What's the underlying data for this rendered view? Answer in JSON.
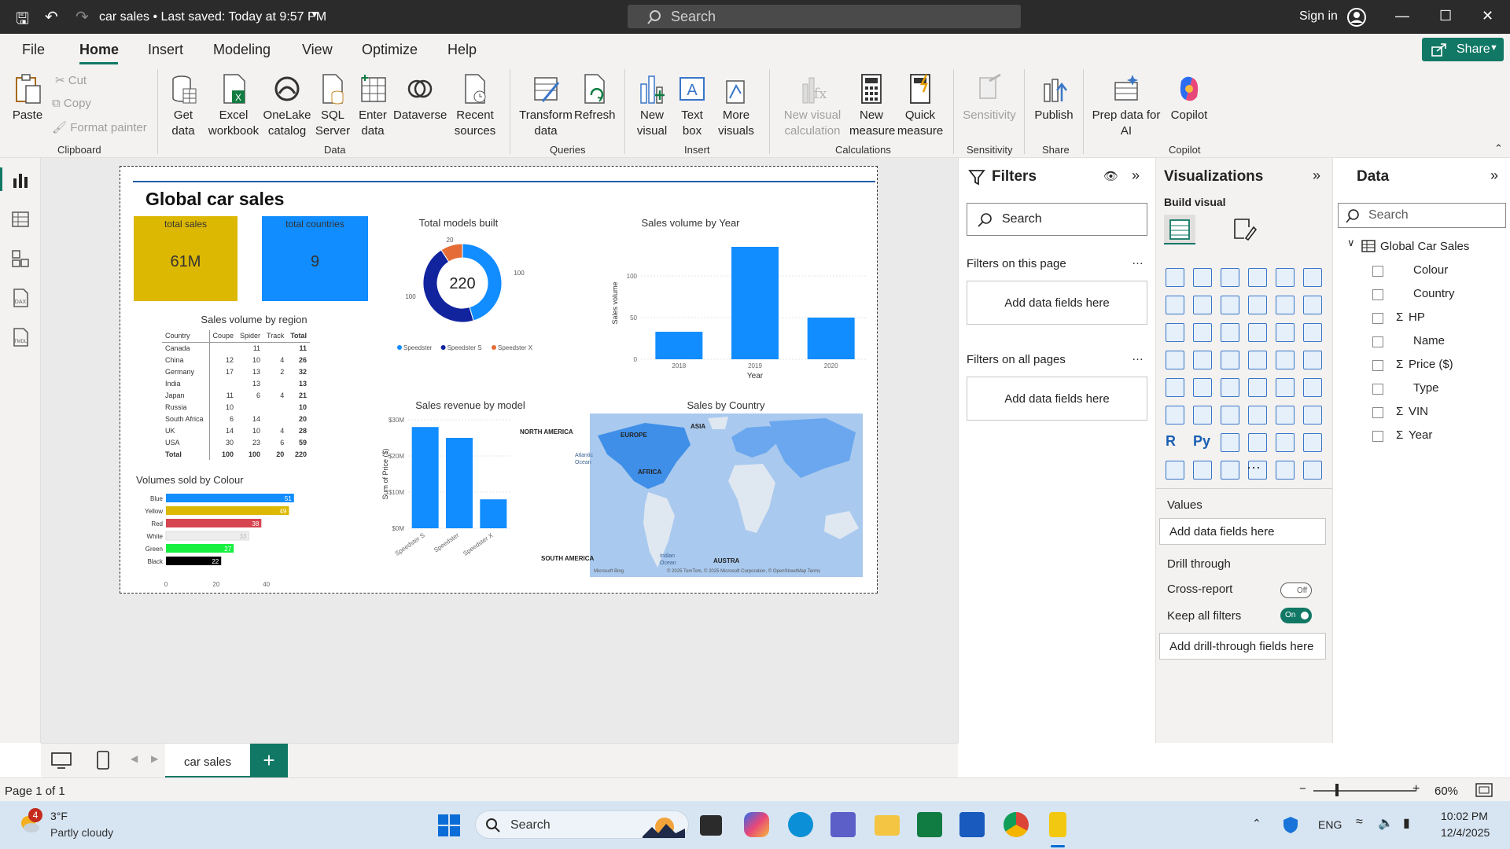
{
  "titlebar": {
    "doc_title": "car sales • Last saved: Today at 9:57 PM",
    "search_placeholder": "Search",
    "signin": "Sign in"
  },
  "menu": {
    "items": [
      "File",
      "Home",
      "Insert",
      "Modeling",
      "View",
      "Optimize",
      "Help"
    ],
    "active": "Home",
    "share": "Share"
  },
  "ribbon": {
    "paste": "Paste",
    "cut": "Cut",
    "copy": "Copy",
    "format_painter": "Format painter",
    "get_data": "Get data",
    "excel": "Excel workbook",
    "onelake": "OneLake catalog",
    "sql": "SQL Server",
    "enter_data": "Enter data",
    "dataverse": "Dataverse",
    "recent": "Recent sources",
    "transform": "Transform data",
    "refresh": "Refresh",
    "new_visual": "New visual",
    "text_box": "Text box",
    "more_visuals": "More visuals",
    "new_visual_calc": "New visual calculation",
    "new_measure": "New measure",
    "quick_measure": "Quick measure",
    "sensitivity": "Sensitivity",
    "publish": "Publish",
    "prep_ai": "Prep data for AI",
    "copilot": "Copilot",
    "groups": {
      "clipboard": "Clipboard",
      "data": "Data",
      "queries": "Queries",
      "insert": "Insert",
      "calculations": "Calculations",
      "sensitivity": "Sensitivity",
      "share": "Share",
      "copilot": "Copilot"
    }
  },
  "report": {
    "title": "Global car sales",
    "kpi_sales": {
      "label": "total sales",
      "value": "61M"
    },
    "kpi_countries": {
      "label": "total countries",
      "value": "9"
    },
    "matrix_title": "Sales volume by region",
    "matrix_headers": [
      "Country",
      "Coupe",
      "Spider",
      "Track",
      "Total"
    ],
    "matrix_rows": [
      [
        "Canada",
        "",
        "11",
        "",
        "11"
      ],
      [
        "China",
        "12",
        "10",
        "4",
        "26"
      ],
      [
        "Germany",
        "17",
        "13",
        "2",
        "32"
      ],
      [
        "India",
        "",
        "13",
        "",
        "13"
      ],
      [
        "Japan",
        "11",
        "6",
        "4",
        "21"
      ],
      [
        "Russia",
        "10",
        "",
        "",
        "10"
      ],
      [
        "South Africa",
        "6",
        "14",
        "",
        "20"
      ],
      [
        "UK",
        "14",
        "10",
        "4",
        "28"
      ],
      [
        "USA",
        "30",
        "23",
        "6",
        "59"
      ],
      [
        "Total",
        "100",
        "100",
        "20",
        "220"
      ]
    ],
    "map_title": "Sales by Country",
    "map_labels": [
      "NORTH AMERICA",
      "EUROPE",
      "ASIA",
      "AFRICA",
      "SOUTH AMERICA",
      "Atlantic Ocean",
      "Indian Ocean",
      "AUSTRA"
    ],
    "map_credit": "© 2025 TomTom, © 2025 Microsoft Corporation, © OpenStreetMap Terms",
    "map_brand": "Microsoft Bing"
  },
  "chart_data": [
    {
      "type": "pie",
      "title": "Total models built",
      "center_label": "220",
      "categories": [
        "Speedster",
        "Speedster S",
        "Speedster X"
      ],
      "values": [
        100,
        100,
        20
      ],
      "colors": [
        "#118DFF",
        "#12239E",
        "#E66C37"
      ],
      "data_labels": [
        "100",
        "100",
        "20"
      ]
    },
    {
      "type": "bar",
      "title": "Sales volume by Year",
      "categories": [
        "2018",
        "2019",
        "2020"
      ],
      "values": [
        33,
        135,
        50
      ],
      "xlabel": "Year",
      "ylabel": "Sales volume",
      "ylim": [
        0,
        135
      ],
      "yticks": [
        "0",
        "50",
        "100"
      ],
      "color": "#118DFF"
    },
    {
      "type": "bar",
      "title": "Sales revenue by model",
      "categories": [
        "Speedster S",
        "Speedster",
        "Speedster X"
      ],
      "values": [
        28,
        25,
        8
      ],
      "ylabel": "Sum of Price ($)",
      "ylim": [
        0,
        30
      ],
      "yticks": [
        "$0M",
        "$10M",
        "$20M",
        "$30M"
      ],
      "color": "#118DFF"
    },
    {
      "type": "bar",
      "title": "Volumes sold by Colour",
      "orientation": "horizontal",
      "categories": [
        "Blue",
        "Yellow",
        "Red",
        "White",
        "Green",
        "Black"
      ],
      "values": [
        51,
        49,
        38,
        33,
        27,
        22
      ],
      "colors": [
        "#118DFF",
        "#DDB802",
        "#D64550",
        "#EDEDED",
        "#18F040",
        "#000000"
      ],
      "xticks": [
        "0",
        "20",
        "40"
      ],
      "xlim": [
        0,
        52
      ]
    }
  ],
  "filters": {
    "title": "Filters",
    "search": "Search",
    "this_page": "Filters on this page",
    "all_pages": "Filters on all pages",
    "add": "Add data fields here"
  },
  "viz": {
    "title": "Visualizations",
    "build": "Build visual",
    "values": "Values",
    "add": "Add data fields here",
    "drill": "Drill through",
    "cross": "Cross-report",
    "cross_state": "Off",
    "keep": "Keep all filters",
    "keep_state": "On",
    "drill_add": "Add drill-through fields here",
    "more": "···"
  },
  "data": {
    "title": "Data",
    "search": "Search",
    "table": "Global Car Sales",
    "fields": [
      "Colour",
      "Country",
      "HP",
      "Name",
      "Price ($)",
      "Type",
      "VIN",
      "Year"
    ],
    "sigma": [
      false,
      false,
      true,
      false,
      true,
      false,
      true,
      true
    ]
  },
  "tabs": {
    "page": "car sales",
    "add": "+"
  },
  "status": {
    "page": "Page 1 of 1",
    "zoom": "60%"
  },
  "taskbar": {
    "temp": "3°F",
    "weather": "Partly cloudy",
    "badge": "4",
    "search": "Search",
    "lang": "ENG",
    "time": "10:02 PM",
    "date": "12/4/2025"
  }
}
